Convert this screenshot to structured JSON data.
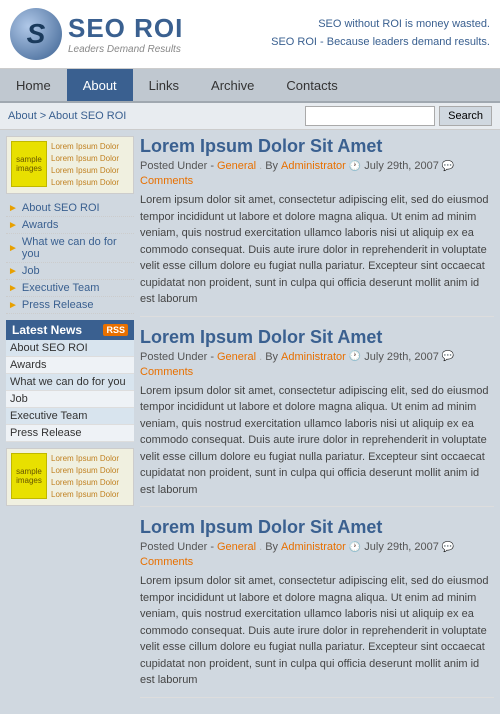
{
  "header": {
    "logo_letter": "S",
    "logo_title": "SEO ROI",
    "logo_subtitle": "Leaders Demand Results",
    "tagline1": "SEO without ROI is money wasted.",
    "tagline2": "SEO ROI - Because leaders demand results."
  },
  "nav": {
    "items": [
      {
        "label": "Home",
        "active": false
      },
      {
        "label": "About",
        "active": true
      },
      {
        "label": "Links",
        "active": false
      },
      {
        "label": "Archive",
        "active": false
      },
      {
        "label": "Contacts",
        "active": false
      }
    ]
  },
  "breadcrumb": {
    "path": "About  >  About SEO ROI"
  },
  "search": {
    "placeholder": "",
    "button_label": "Search"
  },
  "sidebar": {
    "sample_top_label": "sample\nimages",
    "lorem_lines": [
      "Lorem Ipsum Dolor",
      "Lorem Ipsum Dolor",
      "Lorem Ipsum Dolor",
      "Lorem Ipsum Dolor"
    ],
    "menu_items": [
      "About SEO ROI",
      "Awards",
      "What we can do for you",
      "Job",
      "Executive Team",
      "Press Release"
    ],
    "latest_news_label": "Latest News",
    "rss_label": "RSS",
    "news_items": [
      "About SEO ROI",
      "Awards",
      "What we can do for you",
      "Job",
      "Executive Team",
      "Press Release"
    ],
    "sample_bot_label": "sample\nimages"
  },
  "posts": [
    {
      "title": "Lorem Ipsum Dolor Sit Amet",
      "meta_under": "Posted Under -",
      "meta_category": "General",
      "meta_by": "By",
      "meta_author": "Administrator",
      "meta_date": "July 29th, 2007",
      "meta_comments": "Comments",
      "body": "Lorem ipsum dolor sit amet, consectetur adipiscing elit, sed do eiusmod tempor incididunt ut labore et dolore magna aliqua. Ut enim ad minim veniam, quis nostrud exercitation ullamco laboris nisi ut aliquip ex ea commodo consequat. Duis aute irure dolor in reprehenderit in voluptate velit esse cillum dolore eu fugiat nulla pariatur. Excepteur sint occaecat cupidatat non proident, sunt in culpa qui officia deserunt mollit anim id est laborum"
    },
    {
      "title": "Lorem Ipsum Dolor Sit Amet",
      "meta_under": "Posted Under -",
      "meta_category": "General",
      "meta_by": "By",
      "meta_author": "Administrator",
      "meta_date": "July 29th, 2007",
      "meta_comments": "Comments",
      "body": "Lorem ipsum dolor sit amet, consectetur adipiscing elit, sed do eiusmod tempor incididunt ut labore et dolore magna aliqua. Ut enim ad minim veniam, quis nostrud exercitation ullamco laboris nisi ut aliquip ex ea commodo consequat. Duis aute irure dolor in reprehenderit in voluptate velit esse cillum dolore eu fugiat nulla pariatur. Excepteur sint occaecat cupidatat non proident, sunt in culpa qui officia deserunt mollit anim id est laborum"
    },
    {
      "title": "Lorem Ipsum Dolor Sit Amet",
      "meta_under": "Posted Under -",
      "meta_category": "General",
      "meta_by": "By",
      "meta_author": "Administrator",
      "meta_date": "July 29th, 2007",
      "meta_comments": "Comments",
      "body": "Lorem ipsum dolor sit amet, consectetur adipiscing elit, sed do eiusmod tempor incididunt ut labore et dolore magna aliqua. Ut enim ad minim veniam, quis nostrud exercitation ullamco laboris nisi ut aliquip ex ea commodo consequat. Duis aute irure dolor in reprehenderit in voluptate velit esse cillum dolore eu fugiat nulla pariatur. Excepteur sint occaecat cupidatat non proident, sunt in culpa qui officia deserunt mollit anim id est laborum"
    }
  ]
}
